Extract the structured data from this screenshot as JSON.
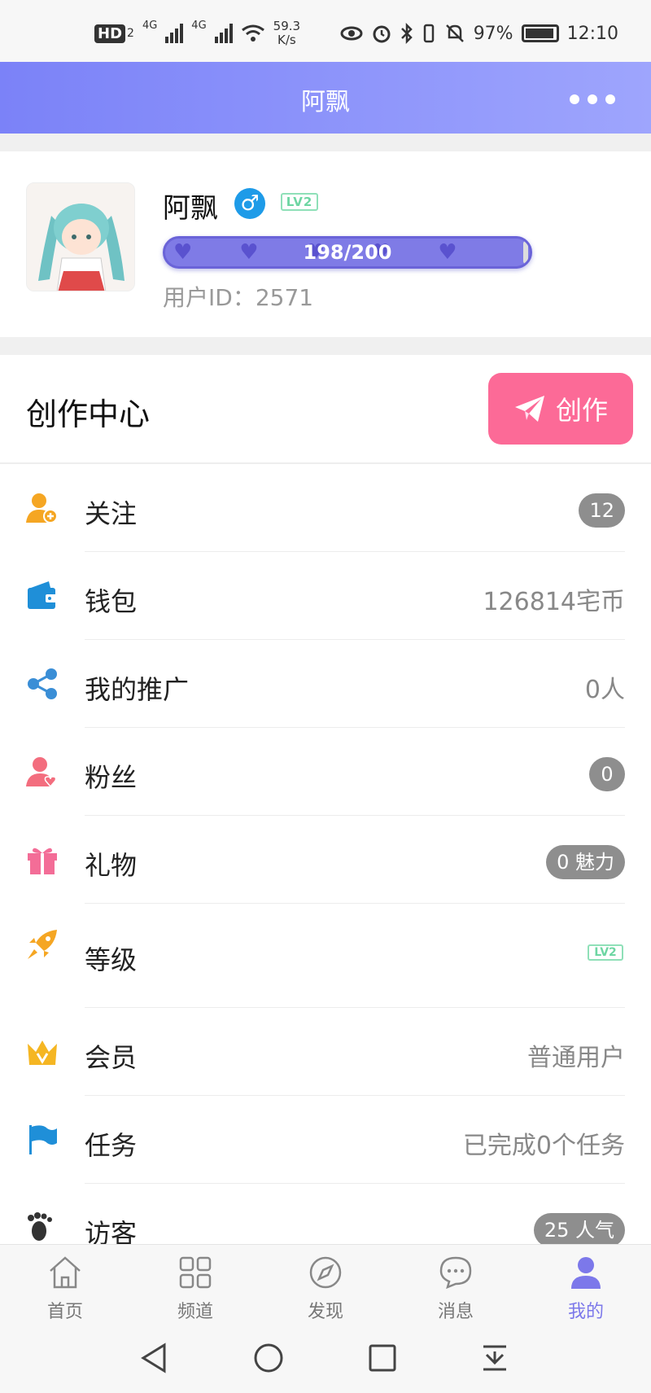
{
  "status_bar": {
    "hd_label": "HD",
    "sim_index": "2",
    "network_type_1": "4G",
    "network_type_2": "4G",
    "speed_value": "59.3",
    "speed_unit": "K/s",
    "battery_percent": "97%",
    "time": "12:10"
  },
  "header": {
    "title": "阿飘",
    "more_icon": "more-dots-icon"
  },
  "profile": {
    "username": "阿飘",
    "gender_symbol": "♂",
    "level_badge": "LV2",
    "xp_text": "198/200",
    "xp_progress": 0.99,
    "user_id_label": "用户ID：2571"
  },
  "create_center": {
    "title": "创作中心",
    "button_label": "创作"
  },
  "menu": [
    {
      "label": "关注",
      "value": "12",
      "icon": "user-add-icon",
      "color": "#f5a623"
    },
    {
      "label": "钱包",
      "value": "126814宅币",
      "icon": "wallet-icon",
      "color": "#1f8fd8"
    },
    {
      "label": "我的推广",
      "value": "0人",
      "icon": "share-icon",
      "color": "#3a8ed6"
    },
    {
      "label": "粉丝",
      "value": "0",
      "icon": "fans-icon",
      "color": "#f36d7e"
    },
    {
      "label": "礼物",
      "value": "0 魅力",
      "icon": "gift-icon",
      "color": "#f36d97"
    },
    {
      "label": "等级",
      "value": "LV2",
      "icon": "rocket-icon",
      "color": "#f5a623"
    },
    {
      "label": "会员",
      "value": "普通用户",
      "icon": "crown-icon",
      "color": "#f5b623"
    },
    {
      "label": "任务",
      "value": "已完成0个任务",
      "icon": "flag-icon",
      "color": "#1f8fd8"
    },
    {
      "label": "访客",
      "value": "25 人气",
      "icon": "footprint-icon",
      "color": "#333333"
    }
  ],
  "tabs": [
    {
      "label": "首页",
      "icon": "home-icon"
    },
    {
      "label": "频道",
      "icon": "grid-icon"
    },
    {
      "label": "发现",
      "icon": "compass-icon"
    },
    {
      "label": "消息",
      "icon": "chat-icon"
    },
    {
      "label": "我的",
      "icon": "profile-icon",
      "active": true
    }
  ],
  "colors": {
    "header_gradient_start": "#7b82f8",
    "header_gradient_end": "#9ea5fd",
    "create_button": "#fc6a97",
    "active_tab": "#7c78ea"
  }
}
